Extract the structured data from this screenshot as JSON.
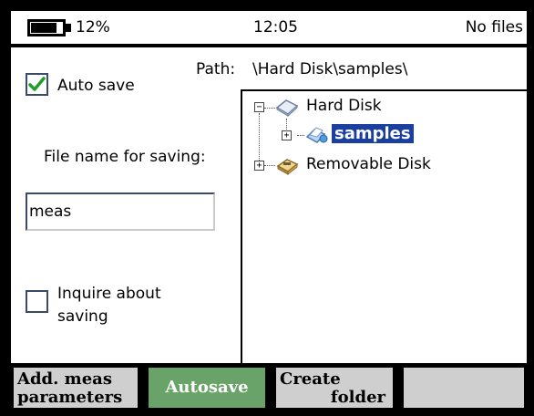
{
  "status_bar": {
    "battery_percent": 12,
    "battery_level_text": "12%",
    "clock": "12:05",
    "media_status": "No files"
  },
  "settings": {
    "auto_save": {
      "label": "Auto save",
      "checked": true
    },
    "path_label": "Path:",
    "path_value": "\\Hard Disk\\samples\\",
    "file_name_label": "File name for saving:",
    "file_name_value": "meas",
    "inquire": {
      "label": "Inquire about saving",
      "checked": false
    }
  },
  "tree": {
    "nodes": [
      {
        "label": "Hard Disk",
        "icon": "hard-disk-icon",
        "expander": "minus",
        "level": 0
      },
      {
        "label": "samples",
        "icon": "folder-icon",
        "expander": "plus",
        "level": 1,
        "selected": true
      },
      {
        "label": "Removable Disk",
        "icon": "removable-disk-icon",
        "expander": "plus",
        "level": 0
      }
    ]
  },
  "softkeys": {
    "key1_line1": "Add. meas",
    "key1_line2": "parameters",
    "key2": "Autosave",
    "key3_line1": "Create",
    "key3_line2": "folder",
    "key4": ""
  },
  "colors": {
    "selection": "#1a3f9e",
    "active_softkey": "#6aa36a",
    "softkey": "#cfcfcf",
    "check_mark": "#1f9e2a"
  }
}
